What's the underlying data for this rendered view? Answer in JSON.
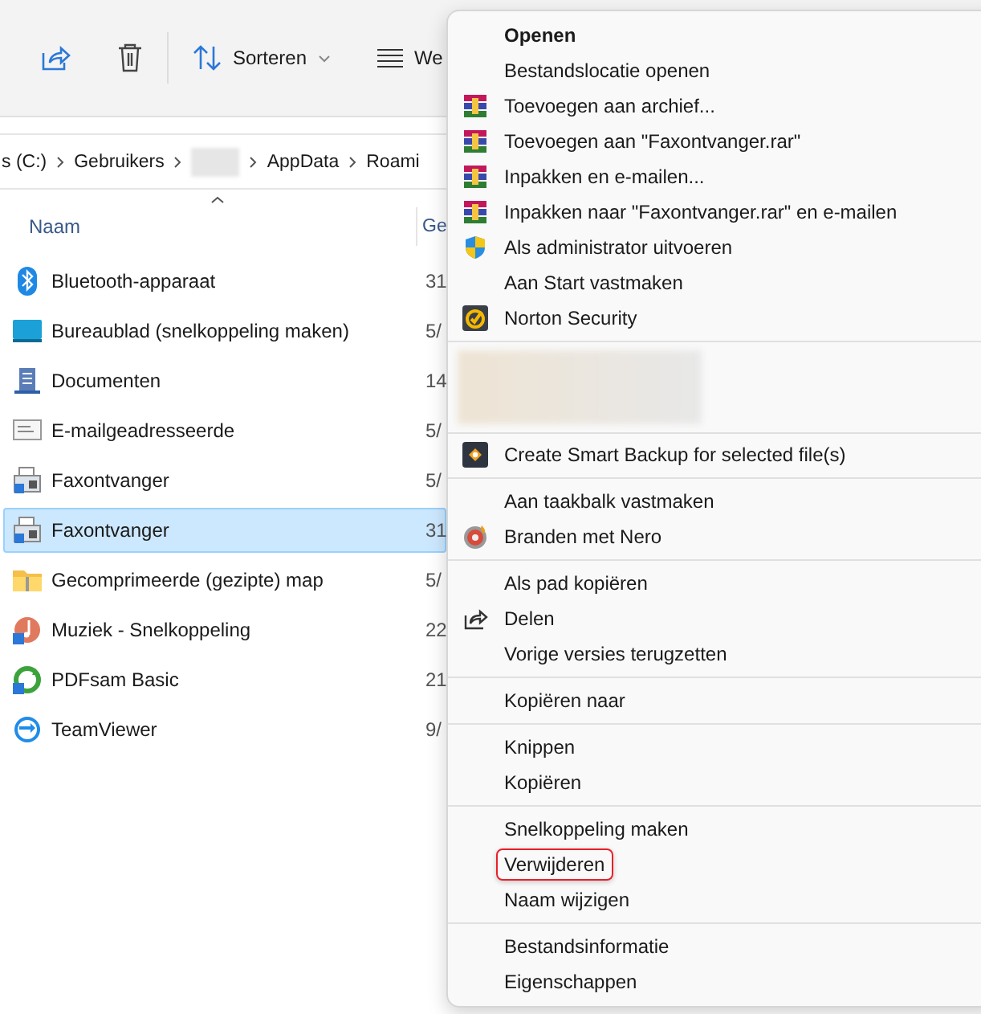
{
  "toolbar": {
    "sort_label": "Sorteren",
    "view_label": "We"
  },
  "breadcrumb": [
    {
      "kind": "text",
      "label": "s (C:)"
    },
    {
      "kind": "text",
      "label": "Gebruikers"
    },
    {
      "kind": "blurred"
    },
    {
      "kind": "text",
      "label": "AppData"
    },
    {
      "kind": "text",
      "label": "Roami"
    }
  ],
  "columns": {
    "name": "Naam",
    "column_2": "Ge"
  },
  "files": [
    {
      "kind": "bluetooth",
      "name": "Bluetooth-apparaat",
      "column_2": "31",
      "selected": false
    },
    {
      "kind": "desktop",
      "name": "Bureaublad (snelkoppeling maken)",
      "column_2": "5/",
      "selected": false
    },
    {
      "kind": "document",
      "name": "Documenten",
      "column_2": "14",
      "selected": false
    },
    {
      "kind": "mail",
      "name": "E-mailgeadresseerde",
      "column_2": "5/",
      "selected": false
    },
    {
      "kind": "fax",
      "name": "Faxontvanger",
      "column_2": "5/",
      "selected": false
    },
    {
      "kind": "fax",
      "name": "Faxontvanger",
      "column_2": "31",
      "selected": true
    },
    {
      "kind": "zip",
      "name": "Gecomprimeerde (gezipte) map",
      "column_2": "5/",
      "selected": false
    },
    {
      "kind": "music",
      "name": "Muziek - Snelkoppeling",
      "column_2": "22",
      "selected": false
    },
    {
      "kind": "pdfsam",
      "name": "PDFsam Basic",
      "column_2": "21",
      "selected": false
    },
    {
      "kind": "teamviewer",
      "name": "TeamViewer",
      "column_2": "9/",
      "selected": false
    }
  ],
  "context_menu": [
    {
      "kind": "items",
      "items": [
        {
          "kind": "plain",
          "label": "Openen",
          "bold": true,
          "highlighted": false
        },
        {
          "kind": "plain",
          "label": "Bestandslocatie openen",
          "bold": false,
          "highlighted": false
        },
        {
          "kind": "winrar",
          "label": "Toevoegen aan archief...",
          "bold": false,
          "highlighted": false
        },
        {
          "kind": "winrar",
          "label": "Toevoegen aan \"Faxontvanger.rar\"",
          "bold": false,
          "highlighted": false
        },
        {
          "kind": "winrar",
          "label": "Inpakken en e-mailen...",
          "bold": false,
          "highlighted": false
        },
        {
          "kind": "winrar",
          "label": "Inpakken naar \"Faxontvanger.rar\" en e-mailen",
          "bold": false,
          "highlighted": false
        },
        {
          "kind": "shield",
          "label": "Als administrator uitvoeren",
          "bold": false,
          "highlighted": false
        },
        {
          "kind": "plain",
          "label": "Aan Start vastmaken",
          "bold": false,
          "highlighted": false
        },
        {
          "kind": "norton",
          "label": "Norton Security",
          "bold": false,
          "highlighted": false
        }
      ]
    },
    {
      "kind": "blurred"
    },
    {
      "kind": "items",
      "items": [
        {
          "kind": "backup",
          "label": "Create Smart Backup for selected file(s)",
          "bold": false,
          "highlighted": false
        }
      ]
    },
    {
      "kind": "items",
      "items": [
        {
          "kind": "plain",
          "label": "Aan taakbalk vastmaken",
          "bold": false,
          "highlighted": false
        },
        {
          "kind": "nero",
          "label": "Branden met Nero",
          "bold": false,
          "highlighted": false
        }
      ]
    },
    {
      "kind": "items",
      "items": [
        {
          "kind": "plain",
          "label": "Als pad kopiëren",
          "bold": false,
          "highlighted": false
        },
        {
          "kind": "share",
          "label": "Delen",
          "bold": false,
          "highlighted": false
        },
        {
          "kind": "plain",
          "label": "Vorige versies terugzetten",
          "bold": false,
          "highlighted": false
        }
      ]
    },
    {
      "kind": "items",
      "items": [
        {
          "kind": "plain",
          "label": "Kopiëren naar",
          "bold": false,
          "highlighted": false
        }
      ]
    },
    {
      "kind": "items",
      "items": [
        {
          "kind": "plain",
          "label": "Knippen",
          "bold": false,
          "highlighted": false
        },
        {
          "kind": "plain",
          "label": "Kopiëren",
          "bold": false,
          "highlighted": false
        }
      ]
    },
    {
      "kind": "items",
      "items": [
        {
          "kind": "plain",
          "label": "Snelkoppeling maken",
          "bold": false,
          "highlighted": false
        },
        {
          "kind": "plain",
          "label": "Verwijderen",
          "bold": false,
          "highlighted": true
        },
        {
          "kind": "plain",
          "label": "Naam wijzigen",
          "bold": false,
          "highlighted": false
        }
      ]
    },
    {
      "kind": "items",
      "items": [
        {
          "kind": "plain",
          "label": "Bestandsinformatie",
          "bold": false,
          "highlighted": false
        },
        {
          "kind": "plain",
          "label": "Eigenschappen",
          "bold": false,
          "highlighted": false
        }
      ]
    }
  ]
}
